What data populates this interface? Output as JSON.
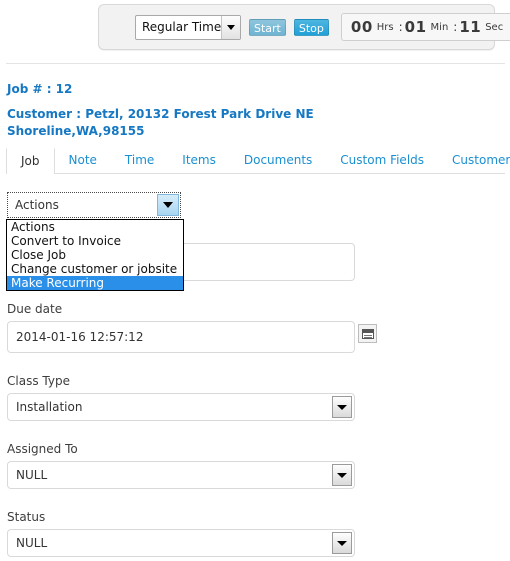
{
  "timer": {
    "time_type": "Regular Time",
    "start_label": "Start",
    "stop_label": "Stop",
    "hours": "00",
    "hours_unit": "Hrs",
    "minutes": "01",
    "minutes_unit": "Min",
    "seconds": "11",
    "seconds_unit": "Sec",
    "separator": ":"
  },
  "header": {
    "job_id": "Job # : 12",
    "customer": "Customer : Petzl, 20132 Forest Park Drive NE Shoreline,WA,98155"
  },
  "tabs": [
    {
      "label": "Job",
      "active": true
    },
    {
      "label": "Note",
      "active": false
    },
    {
      "label": "Time",
      "active": false
    },
    {
      "label": "Items",
      "active": false
    },
    {
      "label": "Documents",
      "active": false
    },
    {
      "label": "Custom Fields",
      "active": false
    },
    {
      "label": "Customer info",
      "active": false
    }
  ],
  "form": {
    "actions": {
      "selected": "Actions",
      "options": [
        {
          "label": "Actions",
          "highlighted": false
        },
        {
          "label": "Convert to Invoice",
          "highlighted": false
        },
        {
          "label": "Close Job",
          "highlighted": false
        },
        {
          "label": "Change customer or jobsite",
          "highlighted": false
        },
        {
          "label": "Make Recurring",
          "highlighted": true
        }
      ]
    },
    "note": {
      "value": ""
    },
    "due_date": {
      "label": "Due date",
      "value": "2014-01-16 12:57:12"
    },
    "class_type": {
      "label": "Class Type",
      "value": "Installation"
    },
    "assigned_to": {
      "label": "Assigned To",
      "value": "NULL"
    },
    "status": {
      "label": "Status",
      "value": "NULL"
    }
  },
  "colors": {
    "link": "#1678c2",
    "highlight": "#2a8fe8",
    "stop_button": "#22a0d6",
    "start_button": "#6fb4d2"
  }
}
